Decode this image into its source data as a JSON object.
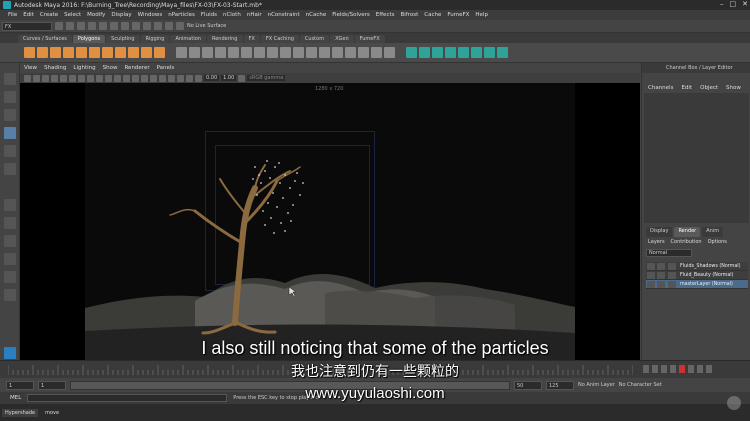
{
  "window": {
    "title": "Autodesk Maya 2016: F:\\Burning_Tree\\Recording\\Maya_files\\FX-03\\FX-03-Start.mb*",
    "controls": [
      "–",
      "□",
      "✕"
    ]
  },
  "menubar": [
    "File",
    "Edit",
    "Create",
    "Select",
    "Modify",
    "Display",
    "Windows",
    "nParticles",
    "Fluids",
    "nCloth",
    "nHair",
    "nConstraint",
    "nCache",
    "Fields/Solvers",
    "Effects",
    "Bifrost",
    "Cache",
    "FumeFX",
    "Help"
  ],
  "status_line": {
    "mode": "FX",
    "live_surface": "No Live Surface"
  },
  "shelf_tabs": [
    "Curves / Surfaces",
    "Polygons",
    "Sculpting",
    "Rigging",
    "Animation",
    "Rendering",
    "FX",
    "FX Caching",
    "Custom",
    "XGen",
    "FumeFX"
  ],
  "shelf_active_tab": "Polygons",
  "panel_menu": [
    "View",
    "Shading",
    "Lighting",
    "Show",
    "Renderer",
    "Panels"
  ],
  "panel_toolbar": {
    "near": "0.00",
    "far": "1.00",
    "color_space": "sRGB gamma"
  },
  "viewport": {
    "resolution_gate": "1280 x 720"
  },
  "channel_box": {
    "title": "Channel Box / Layer Editor",
    "menu": [
      "Channels",
      "Edit",
      "Object",
      "Show"
    ]
  },
  "layer_editor": {
    "tabs": [
      "Display",
      "Render",
      "Anim"
    ],
    "active_tab": "Render",
    "menu": [
      "Layers",
      "Contribution",
      "Options"
    ],
    "blend_mode": "Normal",
    "layers": [
      {
        "name": "Fluids_Shadows (Normal)",
        "selected": false
      },
      {
        "name": "Fluid_Beauty (Normal)",
        "selected": false
      },
      {
        "name": "masterLayer (Normal)",
        "selected": true
      }
    ]
  },
  "timeslider": {
    "start_frame": "1",
    "current_frame": "1",
    "range_start_inner": "1",
    "range_end_inner": "50",
    "range_end": "125",
    "anim_layer": "No Anim Layer",
    "character_set": "No Character Set"
  },
  "command_line": {
    "label": "MEL",
    "help": "Press the ESC key to stop playback"
  },
  "taskbar": [
    "Hypershade",
    "move"
  ],
  "subtitles": {
    "english": "I also still noticing that some of the particles",
    "chinese": "我也注意到仍有一些颗粒的",
    "watermark": "www.yuyulaoshi.com"
  },
  "colors": {
    "viewport_bg": "#0a0a0a",
    "selected_layer": "#4b6b8c",
    "play_button": "#d03030",
    "shelf_icon_orange": "#e09040",
    "shelf_icon_teal": "#2fa39a"
  }
}
